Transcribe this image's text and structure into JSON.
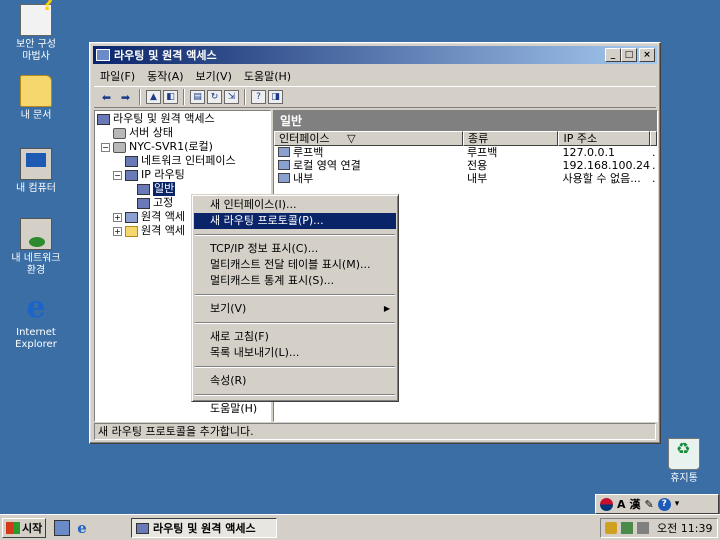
{
  "desktop": {
    "icons": [
      {
        "label": "보안 구성\n마법사",
        "icon": "security-wizard-icon"
      },
      {
        "label": "내 문서",
        "icon": "my-documents-icon"
      },
      {
        "label": "내 컴퓨터",
        "icon": "my-computer-icon"
      },
      {
        "label": "내 네트워크\n환경",
        "icon": "network-places-icon"
      },
      {
        "label": "Internet\nExplorer",
        "icon": "internet-explorer-icon"
      },
      {
        "label": "휴지통",
        "icon": "recycle-bin-icon"
      }
    ]
  },
  "window": {
    "title": "라우팅 및 원격 액세스",
    "menu": [
      "파일(F)",
      "동작(A)",
      "보기(V)",
      "도움말(H)"
    ],
    "tree": {
      "root": "라우팅 및 원격 액세스",
      "server_status": "서버 상태",
      "server": "NYC-SVR1(로컬)",
      "network_interfaces": "네트워크 인터페이스",
      "ip_routing": "IP 라우팅",
      "general": "일반",
      "static": "고정",
      "remote_a": "원격 액세",
      "remote_b": "원격 액세"
    },
    "right": {
      "header": "일반",
      "columns": [
        "인터페이스",
        "종류",
        "IP 주소",
        ""
      ],
      "sort_indicator": "▽",
      "rows": [
        [
          "루프백",
          "루프백",
          "127.0.0.1",
          "."
        ],
        [
          "로컬 영역 연결",
          "전용",
          "192.168.100.24",
          "."
        ],
        [
          "내부",
          "내부",
          "사용할 수 없음...",
          "."
        ]
      ]
    },
    "status": "새 라우팅 프로토콜을 추가합니다."
  },
  "context_menu": {
    "items": [
      {
        "label": "새 인터페이스(I)...",
        "highlight": false
      },
      {
        "label": "새 라우팅 프로토콜(P)...",
        "highlight": true
      },
      {
        "sep": true
      },
      {
        "label": "TCP/IP 정보 표시(C)...",
        "highlight": false
      },
      {
        "label": "멀티캐스트 전달 테이블 표시(M)...",
        "highlight": false
      },
      {
        "label": "멀티캐스트 통계 표시(S)...",
        "highlight": false
      },
      {
        "sep": true
      },
      {
        "label": "보기(V)",
        "highlight": false,
        "submenu": true
      },
      {
        "sep": true
      },
      {
        "label": "새로 고침(F)",
        "highlight": false
      },
      {
        "label": "목록 내보내기(L)...",
        "highlight": false
      },
      {
        "sep": true
      },
      {
        "label": "속성(R)",
        "highlight": false
      },
      {
        "sep": true
      },
      {
        "label": "도움말(H)",
        "highlight": false
      }
    ]
  },
  "langbar": {
    "lang_a": "A",
    "lang_hanja": "漢"
  },
  "taskbar": {
    "start": "시작",
    "task": "라우팅 및 원격 액세스",
    "clock": "오전 11:39"
  }
}
